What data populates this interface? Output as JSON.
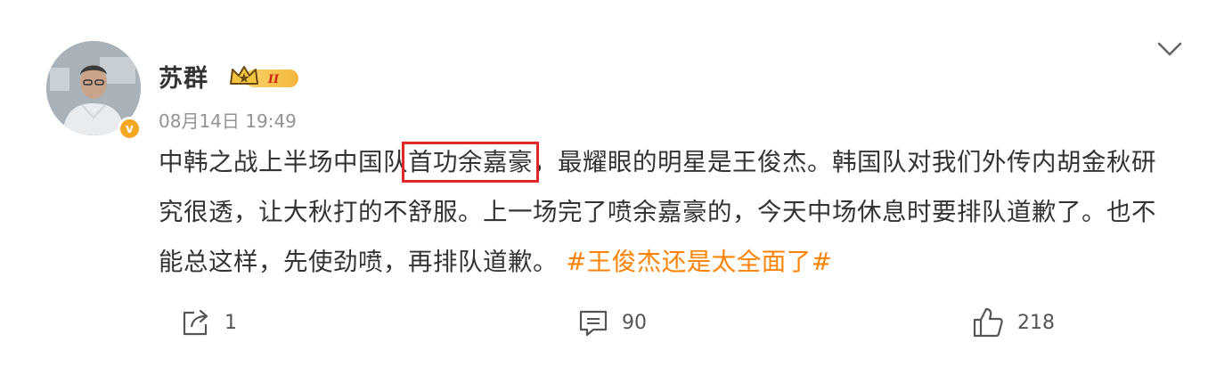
{
  "user": {
    "name": "苏群",
    "badge_text": "II",
    "verified_mark": "v"
  },
  "post": {
    "timestamp": "08月14日 19:49",
    "text_before": "中韩之战上半场中国队",
    "highlight": "首功余嘉豪",
    "text_after": "，最耀眼的明星是王俊杰。韩国队对我们外传内胡金秋研究很透，让大秋打的不舒服。上一场完了喷余嘉豪的，今天中场休息时要排队道歉了。也不能总这样，先使劲喷，再排队道歉。",
    "hashtag": "#王俊杰还是太全面了#"
  },
  "actions": {
    "share_count": "1",
    "comment_count": "90",
    "like_count": "218"
  },
  "colors": {
    "hashtag": "#ff8200",
    "highlight_box": "#e02626",
    "timestamp": "#939393",
    "verified": "#f5a623"
  },
  "icons": [
    "avatar",
    "verified-icon",
    "vip-crown-icon",
    "chevron-down-icon",
    "share-icon",
    "comment-icon",
    "like-icon"
  ]
}
